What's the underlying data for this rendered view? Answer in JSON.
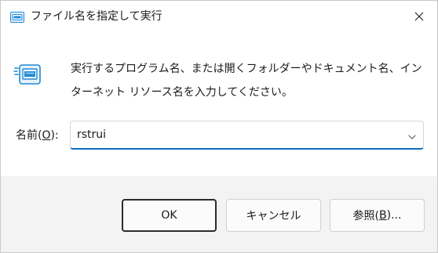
{
  "window": {
    "title": "ファイル名を指定して実行",
    "close_symbol": "✕"
  },
  "message": {
    "line1": "実行するプログラム名、または開くフォルダーやドキュメント名、イン",
    "line2": "ターネット リソース名を入力してください。"
  },
  "open_field": {
    "label_prefix": "名前(",
    "label_accel": "O",
    "label_suffix": "):",
    "value": "rstrui"
  },
  "buttons": {
    "ok": "OK",
    "cancel": "キャンセル",
    "browse_prefix": "参照(",
    "browse_accel": "B",
    "browse_suffix": ")..."
  },
  "icons": {
    "title_icon": "run-dialog-icon",
    "app_icon": "run-app-icon",
    "close_icon": "close-icon",
    "dropdown_icon": "chevron-down-icon"
  },
  "colors": {
    "accent": "#0f6cbd",
    "footer_bg": "#f3f3f3",
    "icon_blue": "#1e88d8"
  }
}
